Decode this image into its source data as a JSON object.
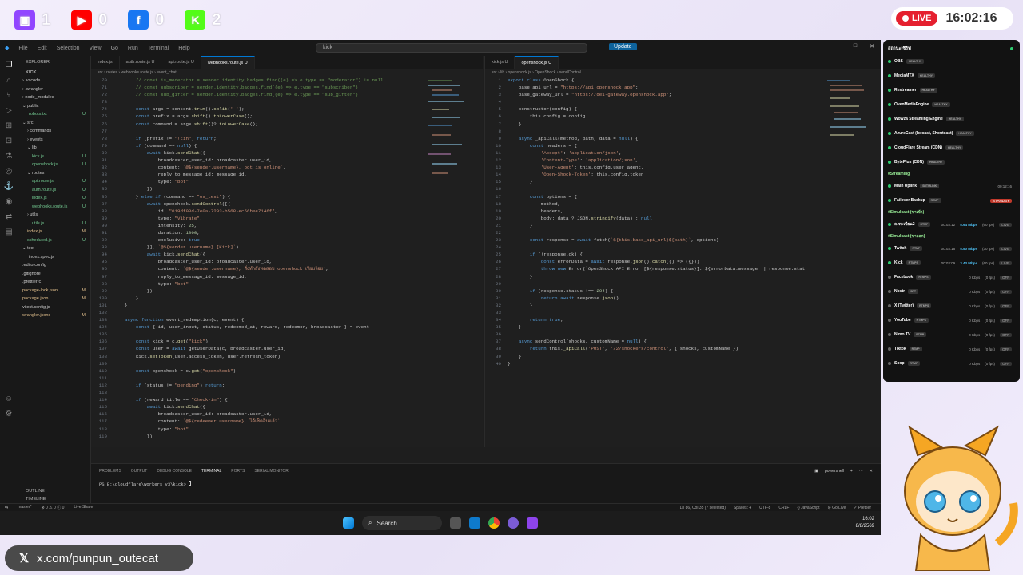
{
  "social": [
    {
      "name": "twitch-icon",
      "count": "1",
      "color": "#9146ff",
      "glyph": "▣"
    },
    {
      "name": "youtube-icon",
      "count": "0",
      "color": "#ff0000",
      "glyph": "▶"
    },
    {
      "name": "facebook-icon",
      "count": "0",
      "color": "#1877f2",
      "glyph": "f"
    },
    {
      "name": "kick-icon",
      "count": "2",
      "color": "#53fc18",
      "glyph": "K"
    }
  ],
  "live": {
    "label": "LIVE",
    "time": "16:02:16"
  },
  "titlebar": {
    "menus": [
      "File",
      "Edit",
      "Selection",
      "View",
      "Go",
      "Run",
      "Terminal",
      "Help"
    ],
    "command": "kick",
    "update": "Update"
  },
  "explorer": {
    "title": "EXPLORER",
    "root": "KICK",
    "items": [
      {
        "label": "› .vscode",
        "indent": 6,
        "status": ""
      },
      {
        "label": "› .wrangler",
        "indent": 6,
        "status": ""
      },
      {
        "label": "› node_modules",
        "indent": 6,
        "status": ""
      },
      {
        "label": "⌄ public",
        "indent": 6,
        "status": ""
      },
      {
        "label": "robots.txt",
        "indent": 14,
        "status": "U"
      },
      {
        "label": "⌄ src",
        "indent": 6,
        "status": ""
      },
      {
        "label": "› commands",
        "indent": 12,
        "status": ""
      },
      {
        "label": "› events",
        "indent": 12,
        "status": ""
      },
      {
        "label": "⌄ lib",
        "indent": 12,
        "status": ""
      },
      {
        "label": "kick.js",
        "indent": 18,
        "status": "U"
      },
      {
        "label": "openshock.js",
        "indent": 18,
        "status": "U"
      },
      {
        "label": "⌄ routes",
        "indent": 12,
        "status": ""
      },
      {
        "label": "api.route.js",
        "indent": 18,
        "status": "U"
      },
      {
        "label": "auth.route.js",
        "indent": 18,
        "status": "U"
      },
      {
        "label": "index.js",
        "indent": 18,
        "status": "U"
      },
      {
        "label": "webhooks.route.js",
        "indent": 18,
        "status": "U"
      },
      {
        "label": "› utils",
        "indent": 12,
        "status": ""
      },
      {
        "label": "utils.js",
        "indent": 18,
        "status": "U"
      },
      {
        "label": "index.js",
        "indent": 12,
        "status": "M"
      },
      {
        "label": "scheduled.js",
        "indent": 12,
        "status": "U"
      },
      {
        "label": "⌄ test",
        "indent": 6,
        "status": ""
      },
      {
        "label": "index.spec.js",
        "indent": 14,
        "status": ""
      },
      {
        "label": ".editorconfig",
        "indent": 6,
        "status": ""
      },
      {
        "label": ".gitignore",
        "indent": 6,
        "status": ""
      },
      {
        "label": ".prettierrc",
        "indent": 6,
        "status": ""
      },
      {
        "label": "package-lock.json",
        "indent": 6,
        "status": "M"
      },
      {
        "label": "package.json",
        "indent": 6,
        "status": "M"
      },
      {
        "label": "vitest.config.js",
        "indent": 6,
        "status": ""
      },
      {
        "label": "wrangler.jsonc",
        "indent": 6,
        "status": "M"
      }
    ],
    "outline": "OUTLINE",
    "timeline": "TIMELINE"
  },
  "editor_left": {
    "tabs": [
      "index.js",
      "auth.route.js U",
      "api.route.js U",
      "webhooks.route.js U"
    ],
    "breadcrumb": "src › routes › webhooks.route.js › event_chat",
    "lines": [
      [
        "70",
        "        // const is_moderator = sender.identity.badges.find((e) => e.type == \"moderator\") != null"
      ],
      [
        "71",
        "        // const subscriber = sender.identity.badges.find((e) => e.type == \"subscriber\")"
      ],
      [
        "72",
        "        // const sub_gifter = sender.identity.badges.find((e) => e.type == \"sub_gifter\")"
      ],
      [
        "73",
        ""
      ],
      [
        "74",
        "        const args = content.trim().split(' ');"
      ],
      [
        "75",
        "        const prefix = args.shift().toLowerCase();"
      ],
      [
        "76",
        "        const command = args.shift()?.toLowerCase();"
      ],
      [
        "77",
        ""
      ],
      [
        "78",
        "        if (prefix != \"!tin\") return;"
      ],
      [
        "79",
        "        if (command == null) {"
      ],
      [
        "80",
        "            await kick.sendChat({"
      ],
      [
        "81",
        "                broadcaster_user_id: broadcaster.user_id,"
      ],
      [
        "82",
        "                content: `@${sender.username}, bot is online`,"
      ],
      [
        "83",
        "                reply_to_message_id: message_id,"
      ],
      [
        "84",
        "                type: \"bot\""
      ],
      [
        "85",
        "            })"
      ],
      [
        "86",
        "        } else if (command == \"os_test\") {"
      ],
      [
        "87",
        "            await openshock.sendControl([{"
      ],
      [
        "88",
        "                id: \"019df93d-7e0a-7203-b568-ec56bee7146f\","
      ],
      [
        "89",
        "                type: \"Vibrate\","
      ],
      [
        "90",
        "                intensity: 25,"
      ],
      [
        "91",
        "                duration: 1000,"
      ],
      [
        "92",
        "                exclusive: true"
      ],
      [
        "93",
        "            }], `@${sender.username} [Kick]`)"
      ],
      [
        "94",
        "            await kick.sendChat({"
      ],
      [
        "95",
        "                broadcaster_user_id: broadcaster.user_id,"
      ],
      [
        "96",
        "                content: `@${sender.username}, สั่งทำสั่งทดสอบ openshock เรียบร้อย`,"
      ],
      [
        "97",
        "                reply_to_message_id: message_id,"
      ],
      [
        "98",
        "                type: \"bot\""
      ],
      [
        "99",
        "            })"
      ],
      [
        "100",
        "        }"
      ],
      [
        "101",
        "    }"
      ],
      [
        "102",
        ""
      ],
      [
        "103",
        "    async function event_redemption(c, event) {"
      ],
      [
        "104",
        "        const { id, user_input, status, redeemed_at, reward, redeemer, broadcaster } = event"
      ],
      [
        "105",
        ""
      ],
      [
        "106",
        "        const kick = c.get(\"kick\")"
      ],
      [
        "107",
        "        const user = await getUserData(c, broadcaster.user_id)"
      ],
      [
        "108",
        "        kick.setToken(user.access_token, user.refresh_token)"
      ],
      [
        "109",
        ""
      ],
      [
        "110",
        "        const openshock = c.get(\"openshock\")"
      ],
      [
        "111",
        ""
      ],
      [
        "112",
        "        if (status != \"pending\") return;"
      ],
      [
        "113",
        ""
      ],
      [
        "114",
        "        if (reward.title == \"Check-in\") {"
      ],
      [
        "115",
        "            await kick.sendChat({"
      ],
      [
        "116",
        "                broadcaster_user_id: broadcaster.user_id,"
      ],
      [
        "117",
        "                content: `@${redeemer.username}, ได้เช็คอินแล้ว`,"
      ],
      [
        "118",
        "                type: \"bot\""
      ],
      [
        "119",
        "            })"
      ]
    ]
  },
  "editor_right": {
    "tabs": [
      "kick.js U",
      "openshock.js U"
    ],
    "breadcrumb": "src › lib › openshock.js › OpenShock › sendControl",
    "lines": [
      [
        "1",
        "export class OpenShock {"
      ],
      [
        "2",
        "    base_api_url = \"https://api.openshock.app\";"
      ],
      [
        "3",
        "    base_gateway_url = \"https://de1-gateway.openshock.app\";"
      ],
      [
        "4",
        ""
      ],
      [
        "5",
        "    constructor(config) {"
      ],
      [
        "6",
        "        this.config = config"
      ],
      [
        "7",
        "    }"
      ],
      [
        "8",
        ""
      ],
      [
        "9",
        "    async _apiCall(method, path, data = null) {"
      ],
      [
        "10",
        "        const headers = {"
      ],
      [
        "11",
        "            'Accept': 'application/json',"
      ],
      [
        "12",
        "            'Content-Type': 'application/json',"
      ],
      [
        "13",
        "            'User-Agent': this.config.user_agent,"
      ],
      [
        "14",
        "            'Open-Shock-Token': this.config.token"
      ],
      [
        "15",
        "        }"
      ],
      [
        "16",
        ""
      ],
      [
        "17",
        "        const options = {"
      ],
      [
        "18",
        "            method,"
      ],
      [
        "19",
        "            headers,"
      ],
      [
        "20",
        "            body: data ? JSON.stringify(data) : null"
      ],
      [
        "21",
        "        }"
      ],
      [
        "22",
        ""
      ],
      [
        "23",
        "        const response = await fetch(`${this.base_api_url}${path}`, options)"
      ],
      [
        "24",
        ""
      ],
      [
        "25",
        "        if (!response.ok) {"
      ],
      [
        "26",
        "            const errorData = await response.json().catch(() => ({}))"
      ],
      [
        "27",
        "            throw new Error(`OpenShock API Error [${response.status}]: ${errorData.message || response.stat"
      ],
      [
        "28",
        "        }"
      ],
      [
        "29",
        ""
      ],
      [
        "30",
        "        if (response.status !== 204) {"
      ],
      [
        "31",
        "            return await response.json()"
      ],
      [
        "32",
        "        }"
      ],
      [
        "33",
        ""
      ],
      [
        "34",
        "        return true;"
      ],
      [
        "35",
        "    }"
      ],
      [
        "36",
        ""
      ],
      [
        "37",
        "    async sendControl(shocks, customName = null) {"
      ],
      [
        "38",
        "        return this._apiCall('POST', '/2/shockers/control', { shocks, customName })"
      ],
      [
        "39",
        "    }"
      ],
      [
        "40",
        "}"
      ]
    ]
  },
  "panel": {
    "tabs": [
      "PROBLEMS",
      "OUTPUT",
      "DEBUG CONSOLE",
      "TERMINAL",
      "PORTS",
      "SERIAL MONITOR"
    ],
    "prompt": "PS E:\\cloudflare\\workers_v3\\kick> ",
    "shell": "powershell"
  },
  "statusbar": {
    "left": [
      "master*",
      "⊗ 0 ⚠ 0 ⓘ 0",
      "Live Share"
    ],
    "right": [
      "Ln 86, Col 35 (7 selected)",
      "Spaces: 4",
      "UTF-8",
      "CRLF",
      "{} JavaScript",
      "⊘ Go Live",
      "✓ Prettier"
    ]
  },
  "taskbar": {
    "search": "Search",
    "time": "16:02",
    "date": "8/8/2569"
  },
  "health": {
    "title": "สถานะเซิร์ฟ",
    "services": [
      {
        "name": "OBS",
        "tag": "HEALTHY"
      },
      {
        "name": "MediaMTX",
        "tag": "HEALTHY"
      },
      {
        "name": "Restreamer",
        "tag": "HEALTHY"
      },
      {
        "name": "OvenMediaEngine",
        "tag": "HEALTHY"
      },
      {
        "name": "Wowza Streaming Engine",
        "tag": "HEALTHY"
      },
      {
        "name": "AzureCast (Icecast, Shoutcast)",
        "tag": "HEALTHY"
      },
      {
        "name": "CloudFlare Stream (CDN)",
        "tag": "HEALTHY"
      },
      {
        "name": "BytePlus (CDN)",
        "tag": "HEALTHY"
      }
    ],
    "streaming_title": "#Streaming",
    "streaming": [
      {
        "name": "Main Uplink",
        "tag": "SRTMLINK",
        "time": "00:12:16",
        "rate": "",
        "fps": "",
        "state": ""
      },
      {
        "name": "Failover Backup",
        "tag": "RTMP",
        "time": "",
        "rate": "",
        "fps": "",
        "state": "STANDBY"
      }
    ],
    "simulcast1_title": "#Simulcast (ขาเข้า)",
    "simulcast1": [
      {
        "name": "ลงทะเบียน2",
        "tag": "RTMP",
        "time": "00:03:12",
        "rate": "5.94 Mbps",
        "fps": "(60 fps)",
        "state": "LIVE"
      }
    ],
    "simulcast2_title": "#Simulcast (ขาออก)",
    "simulcast2": [
      {
        "name": "Twitch",
        "tag": "RTMP",
        "time": "00:03:16",
        "rate": "5.50 Mbps",
        "fps": "(30 fps)",
        "state": "LIVE",
        "on": true
      },
      {
        "name": "Kick",
        "tag": "RTMPS",
        "time": "00:03:09",
        "rate": "3.43 Mbps",
        "fps": "(60 fps)",
        "state": "LIVE",
        "on": true
      },
      {
        "name": "Facebook",
        "tag": "RTMPS",
        "time": "",
        "rate": "0 Kbps",
        "fps": "(0 fps)",
        "state": "OFF",
        "on": false
      },
      {
        "name": "Nostr",
        "tag": "SRT",
        "time": "",
        "rate": "0 Kbps",
        "fps": "(0 fps)",
        "state": "OFF",
        "on": false
      },
      {
        "name": "X (Twitter)",
        "tag": "RTMPS",
        "time": "",
        "rate": "0 Kbps",
        "fps": "(0 fps)",
        "state": "OFF",
        "on": false
      },
      {
        "name": "YouTube",
        "tag": "RTMPS",
        "time": "",
        "rate": "0 Kbps",
        "fps": "(0 fps)",
        "state": "OFF",
        "on": false
      },
      {
        "name": "Nimo TV",
        "tag": "RTMP",
        "time": "",
        "rate": "0 Kbps",
        "fps": "(0 fps)",
        "state": "OFF",
        "on": false
      },
      {
        "name": "Tiktok",
        "tag": "RTMP",
        "time": "",
        "rate": "0 Kbps",
        "fps": "(0 fps)",
        "state": "OFF",
        "on": false
      },
      {
        "name": "Soop",
        "tag": "RTMP",
        "time": "",
        "rate": "0 Kbps",
        "fps": "(0 fps)",
        "state": "OFF",
        "on": false
      }
    ]
  },
  "handle": "x.com/punpun_outecat"
}
